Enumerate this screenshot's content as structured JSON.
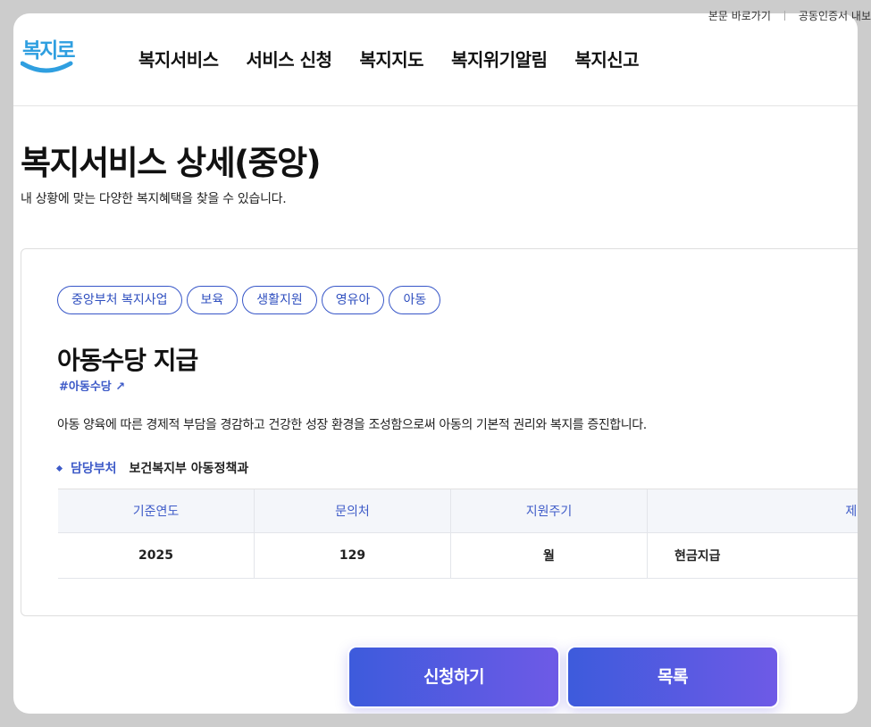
{
  "utility": {
    "skip_link": "본문 바로가기",
    "cert_link": "공동인증서 내보"
  },
  "header": {
    "logo_text": "복지로",
    "nav": [
      "복지서비스",
      "서비스 신청",
      "복지지도",
      "복지위기알림",
      "복지신고"
    ]
  },
  "page": {
    "title": "복지서비스 상세(중앙)",
    "description": "내 상황에 맞는 다양한 복지혜택을 찾을 수 있습니다."
  },
  "service": {
    "tags": [
      "중앙부처 복지사업",
      "보육",
      "생활지원",
      "영유아",
      "아동"
    ],
    "title": "아동수당 지급",
    "hashtag": "#아동수당",
    "description": "아동 양육에 따른 경제적 부담을 경감하고 건강한 성장 환경을 조성함으로써 아동의 기본적 권리와 복지를 증진합니다.",
    "dept_label": "담당부처",
    "dept_value": "보건복지부 아동정책과",
    "table": {
      "headers": [
        "기준연도",
        "문의처",
        "지원주기",
        "제공유"
      ],
      "values": [
        "2025",
        "129",
        "월",
        "현금지급"
      ]
    }
  },
  "actions": {
    "apply": "신청하기",
    "list": "목록"
  },
  "colors": {
    "accent": "#3e5bc8",
    "button_gradient_start": "#3d5bdc",
    "button_gradient_end": "#6e5ae6",
    "logo": "#2f9fe0"
  }
}
